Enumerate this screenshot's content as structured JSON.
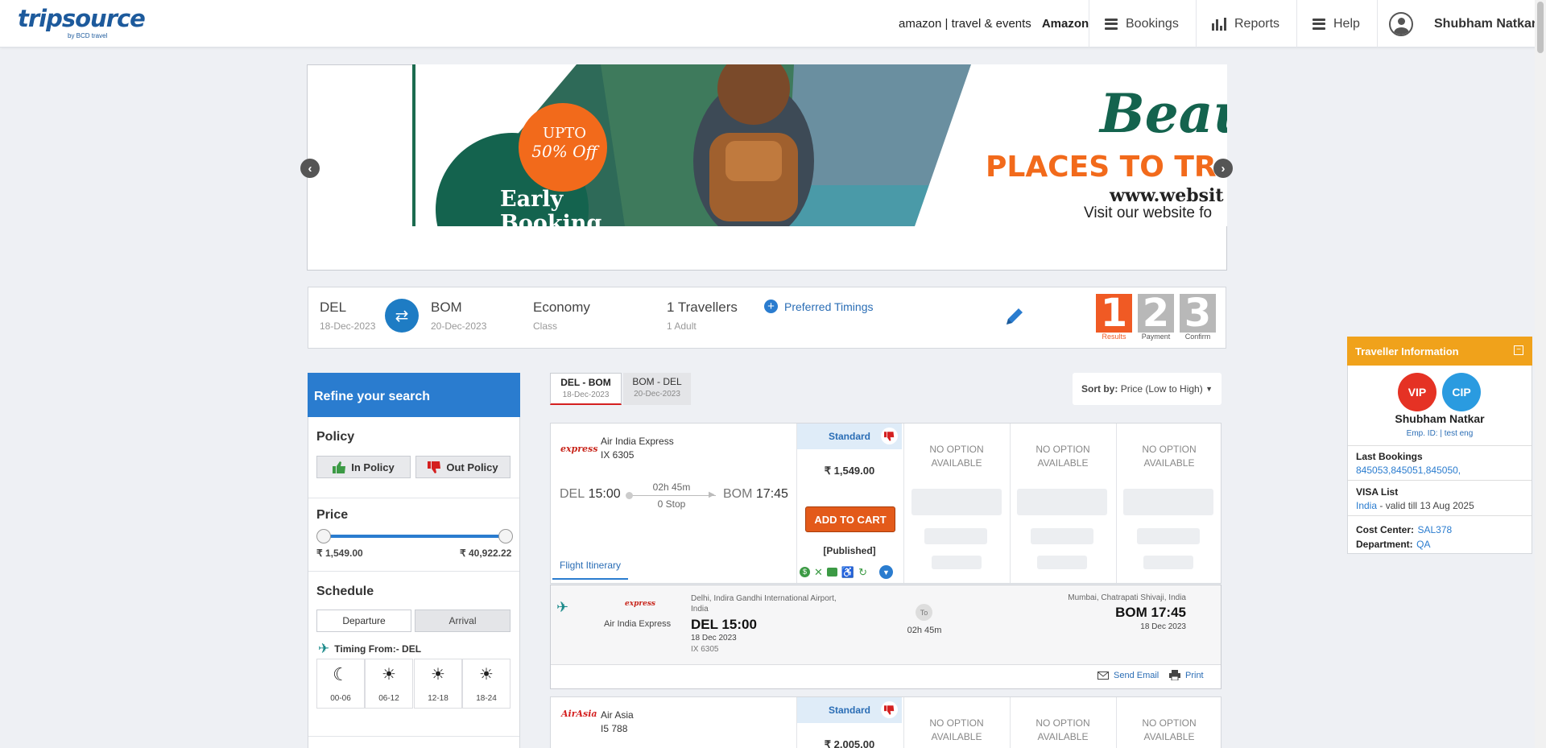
{
  "header": {
    "logo": "tripsource",
    "logo_sub": "by BCD travel",
    "company_brand": "amazon | travel & events",
    "company_name": "Amazon",
    "nav": [
      "Bookings",
      "Reports",
      "Help"
    ],
    "user_name": "Shubham Natkar"
  },
  "banner": {
    "badge_line1": "UPTO",
    "badge_line2": "50% Off",
    "early": "Early",
    "booking": "Booking",
    "headline1": "Beaut",
    "headline2": "PLACES TO TR",
    "website": "www.websit",
    "visit": "Visit our website fo"
  },
  "search": {
    "from_code": "DEL",
    "from_date": "18-Dec-2023",
    "to_code": "BOM",
    "to_date": "20-Dec-2023",
    "cabin": "Economy",
    "cabin_label": "Class",
    "travellers": "1 Travellers",
    "travellers_detail": "1 Adult",
    "preferred_timings": "Preferred Timings",
    "steps": [
      {
        "num": "1",
        "label": "Results",
        "color": "#f05a24"
      },
      {
        "num": "2",
        "label": "Payment",
        "color": "#b8b8b8"
      },
      {
        "num": "3",
        "label": "Confirm",
        "color": "#b8b8b8"
      }
    ]
  },
  "sidebar": {
    "title": "Refine your search",
    "policy_title": "Policy",
    "in_policy": "In Policy",
    "out_policy": "Out Policy",
    "price_title": "Price",
    "price_min": "₹ 1,549.00",
    "price_max": "₹ 40,922.22",
    "schedule_title": "Schedule",
    "departure": "Departure",
    "arrival": "Arrival",
    "timing_from": "Timing From:- DEL",
    "slots": [
      "00-06",
      "06-12",
      "12-18",
      "18-24"
    ]
  },
  "tabs": [
    {
      "route": "DEL  -  BOM",
      "date": "18-Dec-2023"
    },
    {
      "route": "BOM  -  DEL",
      "date": "20-Dec-2023"
    }
  ],
  "sort": {
    "label": "Sort by:",
    "value": "Price (Low to High)"
  },
  "flights": [
    {
      "airline": "Air India Express",
      "logo_text": "express",
      "flight_no": "IX  6305",
      "dep_code": "DEL",
      "dep_time": "15:00",
      "arr_code": "BOM",
      "arr_time": "17:45",
      "duration": "02h 45m",
      "stops": "0 Stop",
      "fare_type": "Standard",
      "price": "₹ 1,549.00",
      "add_to_cart": "ADD TO CART",
      "published": "[Published]",
      "no_option": "NO OPTION AVAILABLE",
      "itinerary_tab": "Flight Itinerary"
    },
    {
      "airline": "Air Asia",
      "logo_text": "AirAsia",
      "flight_no": "I5  788",
      "fare_type": "Standard",
      "price": "₹ 2,005.00",
      "no_option": "NO OPTION AVAILABLE"
    }
  ],
  "itinerary": {
    "airline": "Air India Express",
    "logo_text": "express",
    "dep_airport_line1": "Delhi, Indira Gandhi International Airport,",
    "dep_airport_line2": "India",
    "dep": "DEL 15:00",
    "dep_date": "18 Dec 2023",
    "flight_no": "IX 6305",
    "to": "To",
    "duration": "02h 45m",
    "arr_airport": "Mumbai, Chatrapati Shivaji, India",
    "arr": "BOM 17:45",
    "arr_date": "18 Dec 2023",
    "send_email": "Send Email",
    "print": "Print"
  },
  "traveller": {
    "title": "Traveller Information",
    "vip": "VIP",
    "cip": "CIP",
    "name": "Shubham Natkar",
    "emp_id": "Emp. ID: | test eng",
    "last_bookings_label": "Last Bookings",
    "last_bookings": "845053,845051,845050,",
    "visa_label": "VISA List",
    "visa_country": "India",
    "visa_valid": " - valid till 13 Aug 2025",
    "cost_center_label": "Cost Center:",
    "cost_center": "SAL378",
    "department_label": "Department:",
    "department": "QA"
  }
}
